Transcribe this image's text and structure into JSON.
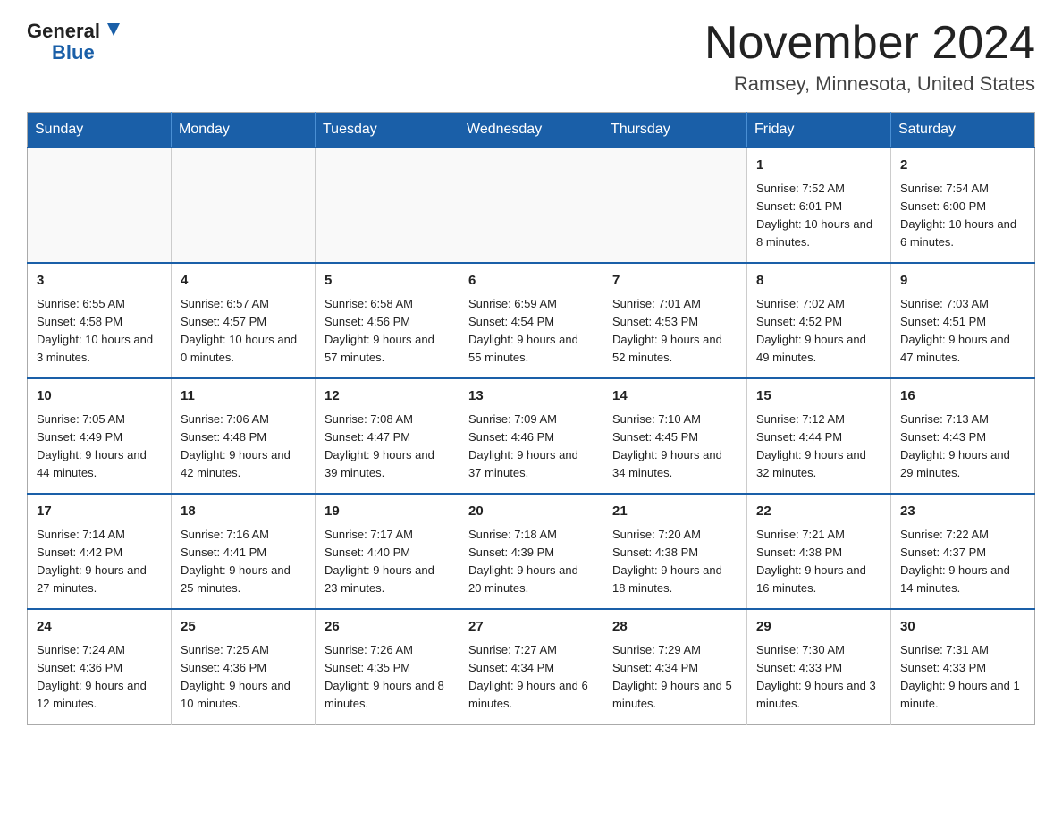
{
  "logo": {
    "text_general": "General",
    "text_blue": "Blue",
    "triangle_color": "#1a5fa8"
  },
  "title": {
    "main": "November 2024",
    "subtitle": "Ramsey, Minnesota, United States"
  },
  "weekdays": [
    "Sunday",
    "Monday",
    "Tuesday",
    "Wednesday",
    "Thursday",
    "Friday",
    "Saturday"
  ],
  "weeks": [
    [
      {
        "day": "",
        "sunrise": "",
        "sunset": "",
        "daylight": ""
      },
      {
        "day": "",
        "sunrise": "",
        "sunset": "",
        "daylight": ""
      },
      {
        "day": "",
        "sunrise": "",
        "sunset": "",
        "daylight": ""
      },
      {
        "day": "",
        "sunrise": "",
        "sunset": "",
        "daylight": ""
      },
      {
        "day": "",
        "sunrise": "",
        "sunset": "",
        "daylight": ""
      },
      {
        "day": "1",
        "sunrise": "Sunrise: 7:52 AM",
        "sunset": "Sunset: 6:01 PM",
        "daylight": "Daylight: 10 hours and 8 minutes."
      },
      {
        "day": "2",
        "sunrise": "Sunrise: 7:54 AM",
        "sunset": "Sunset: 6:00 PM",
        "daylight": "Daylight: 10 hours and 6 minutes."
      }
    ],
    [
      {
        "day": "3",
        "sunrise": "Sunrise: 6:55 AM",
        "sunset": "Sunset: 4:58 PM",
        "daylight": "Daylight: 10 hours and 3 minutes."
      },
      {
        "day": "4",
        "sunrise": "Sunrise: 6:57 AM",
        "sunset": "Sunset: 4:57 PM",
        "daylight": "Daylight: 10 hours and 0 minutes."
      },
      {
        "day": "5",
        "sunrise": "Sunrise: 6:58 AM",
        "sunset": "Sunset: 4:56 PM",
        "daylight": "Daylight: 9 hours and 57 minutes."
      },
      {
        "day": "6",
        "sunrise": "Sunrise: 6:59 AM",
        "sunset": "Sunset: 4:54 PM",
        "daylight": "Daylight: 9 hours and 55 minutes."
      },
      {
        "day": "7",
        "sunrise": "Sunrise: 7:01 AM",
        "sunset": "Sunset: 4:53 PM",
        "daylight": "Daylight: 9 hours and 52 minutes."
      },
      {
        "day": "8",
        "sunrise": "Sunrise: 7:02 AM",
        "sunset": "Sunset: 4:52 PM",
        "daylight": "Daylight: 9 hours and 49 minutes."
      },
      {
        "day": "9",
        "sunrise": "Sunrise: 7:03 AM",
        "sunset": "Sunset: 4:51 PM",
        "daylight": "Daylight: 9 hours and 47 minutes."
      }
    ],
    [
      {
        "day": "10",
        "sunrise": "Sunrise: 7:05 AM",
        "sunset": "Sunset: 4:49 PM",
        "daylight": "Daylight: 9 hours and 44 minutes."
      },
      {
        "day": "11",
        "sunrise": "Sunrise: 7:06 AM",
        "sunset": "Sunset: 4:48 PM",
        "daylight": "Daylight: 9 hours and 42 minutes."
      },
      {
        "day": "12",
        "sunrise": "Sunrise: 7:08 AM",
        "sunset": "Sunset: 4:47 PM",
        "daylight": "Daylight: 9 hours and 39 minutes."
      },
      {
        "day": "13",
        "sunrise": "Sunrise: 7:09 AM",
        "sunset": "Sunset: 4:46 PM",
        "daylight": "Daylight: 9 hours and 37 minutes."
      },
      {
        "day": "14",
        "sunrise": "Sunrise: 7:10 AM",
        "sunset": "Sunset: 4:45 PM",
        "daylight": "Daylight: 9 hours and 34 minutes."
      },
      {
        "day": "15",
        "sunrise": "Sunrise: 7:12 AM",
        "sunset": "Sunset: 4:44 PM",
        "daylight": "Daylight: 9 hours and 32 minutes."
      },
      {
        "day": "16",
        "sunrise": "Sunrise: 7:13 AM",
        "sunset": "Sunset: 4:43 PM",
        "daylight": "Daylight: 9 hours and 29 minutes."
      }
    ],
    [
      {
        "day": "17",
        "sunrise": "Sunrise: 7:14 AM",
        "sunset": "Sunset: 4:42 PM",
        "daylight": "Daylight: 9 hours and 27 minutes."
      },
      {
        "day": "18",
        "sunrise": "Sunrise: 7:16 AM",
        "sunset": "Sunset: 4:41 PM",
        "daylight": "Daylight: 9 hours and 25 minutes."
      },
      {
        "day": "19",
        "sunrise": "Sunrise: 7:17 AM",
        "sunset": "Sunset: 4:40 PM",
        "daylight": "Daylight: 9 hours and 23 minutes."
      },
      {
        "day": "20",
        "sunrise": "Sunrise: 7:18 AM",
        "sunset": "Sunset: 4:39 PM",
        "daylight": "Daylight: 9 hours and 20 minutes."
      },
      {
        "day": "21",
        "sunrise": "Sunrise: 7:20 AM",
        "sunset": "Sunset: 4:38 PM",
        "daylight": "Daylight: 9 hours and 18 minutes."
      },
      {
        "day": "22",
        "sunrise": "Sunrise: 7:21 AM",
        "sunset": "Sunset: 4:38 PM",
        "daylight": "Daylight: 9 hours and 16 minutes."
      },
      {
        "day": "23",
        "sunrise": "Sunrise: 7:22 AM",
        "sunset": "Sunset: 4:37 PM",
        "daylight": "Daylight: 9 hours and 14 minutes."
      }
    ],
    [
      {
        "day": "24",
        "sunrise": "Sunrise: 7:24 AM",
        "sunset": "Sunset: 4:36 PM",
        "daylight": "Daylight: 9 hours and 12 minutes."
      },
      {
        "day": "25",
        "sunrise": "Sunrise: 7:25 AM",
        "sunset": "Sunset: 4:36 PM",
        "daylight": "Daylight: 9 hours and 10 minutes."
      },
      {
        "day": "26",
        "sunrise": "Sunrise: 7:26 AM",
        "sunset": "Sunset: 4:35 PM",
        "daylight": "Daylight: 9 hours and 8 minutes."
      },
      {
        "day": "27",
        "sunrise": "Sunrise: 7:27 AM",
        "sunset": "Sunset: 4:34 PM",
        "daylight": "Daylight: 9 hours and 6 minutes."
      },
      {
        "day": "28",
        "sunrise": "Sunrise: 7:29 AM",
        "sunset": "Sunset: 4:34 PM",
        "daylight": "Daylight: 9 hours and 5 minutes."
      },
      {
        "day": "29",
        "sunrise": "Sunrise: 7:30 AM",
        "sunset": "Sunset: 4:33 PM",
        "daylight": "Daylight: 9 hours and 3 minutes."
      },
      {
        "day": "30",
        "sunrise": "Sunrise: 7:31 AM",
        "sunset": "Sunset: 4:33 PM",
        "daylight": "Daylight: 9 hours and 1 minute."
      }
    ]
  ]
}
